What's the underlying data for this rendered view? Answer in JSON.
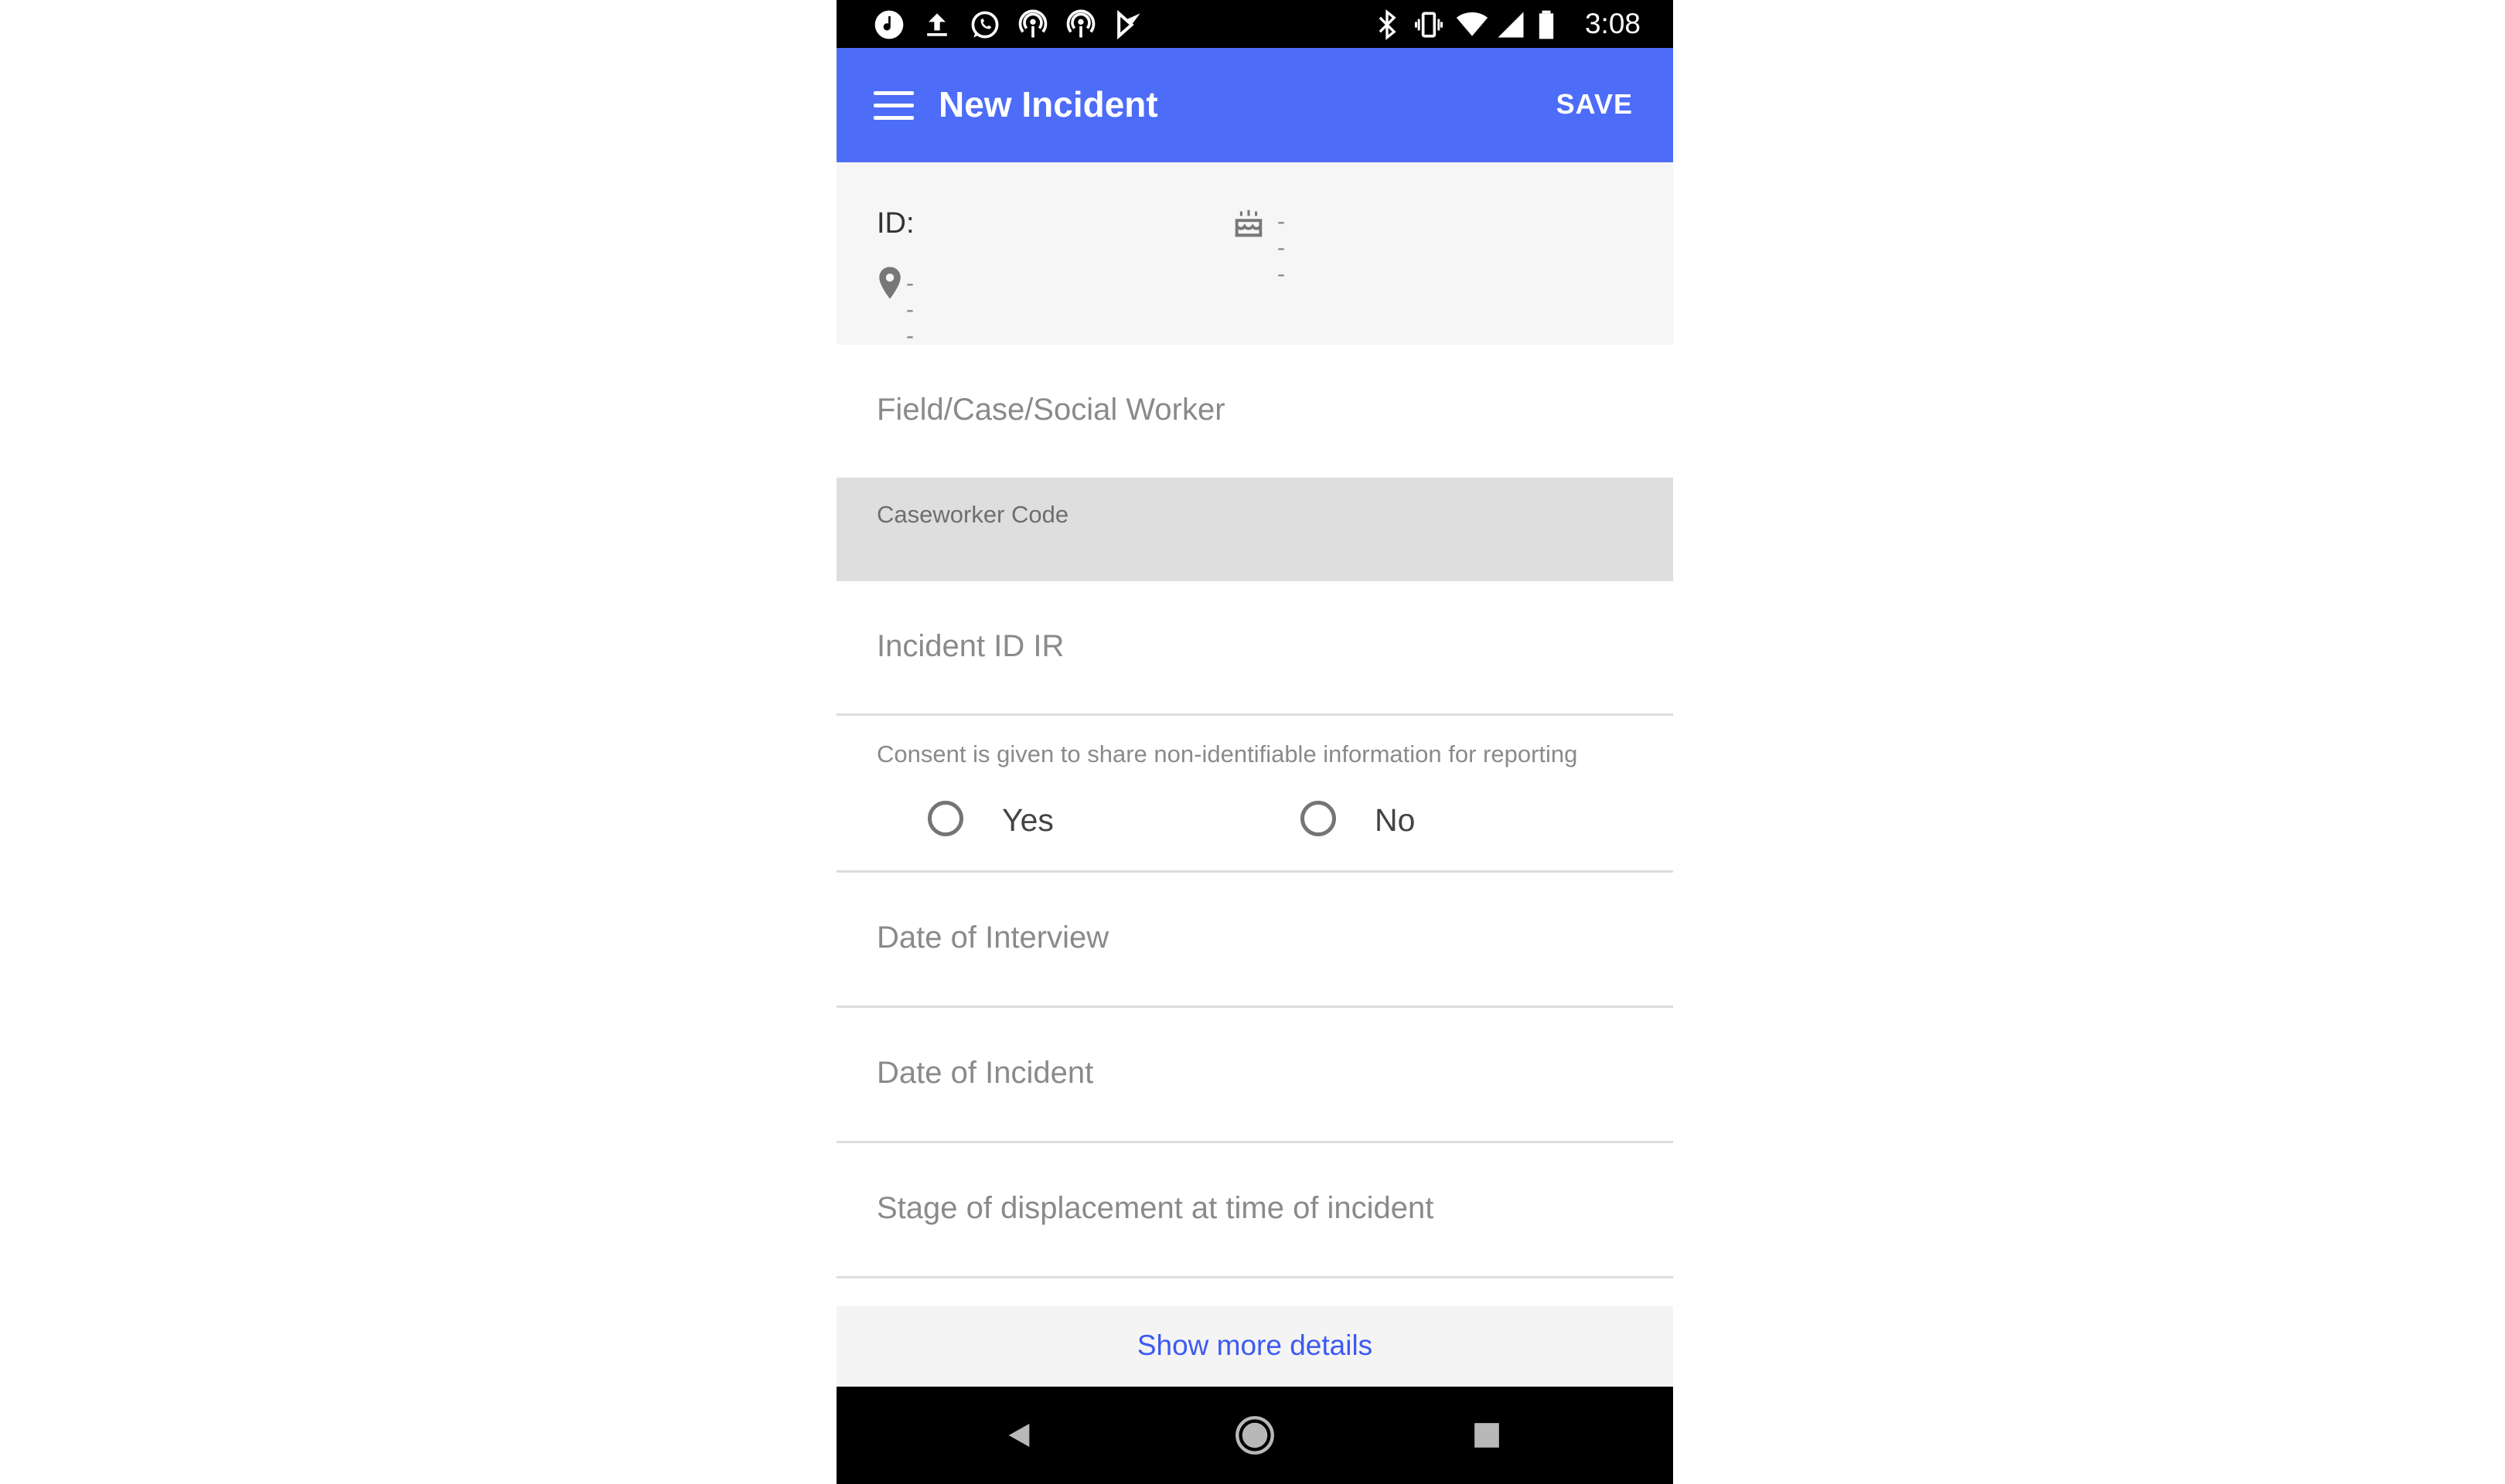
{
  "status_bar": {
    "time": "3:08",
    "left_icons": [
      "music-note-icon",
      "upload-icon",
      "whatsapp-icon",
      "podcast-icon",
      "podcast-icon",
      "play-store-icon"
    ],
    "right_icons": [
      "bluetooth-icon",
      "vibrate-icon",
      "wifi-icon",
      "signal-icon",
      "battery-icon"
    ]
  },
  "app_bar": {
    "title": "New Incident",
    "save_label": "SAVE",
    "color": "#4d6cf7"
  },
  "info": {
    "id_label": "ID:",
    "birthday_value": "---",
    "location_value": "---"
  },
  "form": {
    "worker_label": "Field/Case/Social Worker",
    "caseworker_code_label": "Caseworker Code",
    "incident_id_label": "Incident ID IR",
    "consent_label": "Consent is given to share non-identifiable information for reporting",
    "consent_options": [
      "Yes",
      "No"
    ],
    "interview_date_label": "Date of Interview",
    "incident_date_label": "Date of Incident",
    "displacement_label": "Stage of displacement at time of incident"
  },
  "show_more_label": "Show more details",
  "nav": {
    "icons": [
      "back-icon",
      "home-icon",
      "recents-icon"
    ]
  }
}
